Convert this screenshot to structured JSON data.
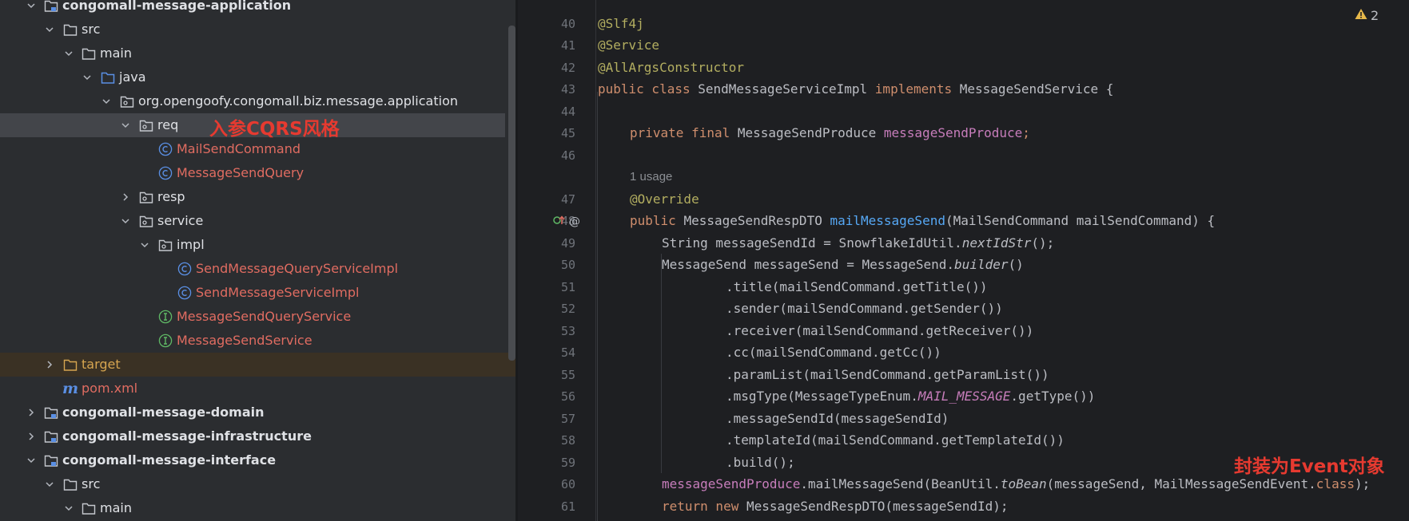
{
  "tree": {
    "items": [
      {
        "label": "congomall-message-application",
        "icon": "module-folder-icon"
      },
      {
        "label": "src",
        "icon": "folder-icon"
      },
      {
        "label": "main",
        "icon": "folder-icon"
      },
      {
        "label": "java",
        "icon": "source-folder-icon"
      },
      {
        "label": "org.opengoofy.congomall.biz.message.application",
        "icon": "package-icon"
      },
      {
        "label": "req",
        "icon": "package-icon"
      },
      {
        "label": "MailSendCommand",
        "icon": "class-icon"
      },
      {
        "label": "MessageSendQuery",
        "icon": "class-icon"
      },
      {
        "label": "resp",
        "icon": "package-icon"
      },
      {
        "label": "service",
        "icon": "package-icon"
      },
      {
        "label": "impl",
        "icon": "package-icon"
      },
      {
        "label": "SendMessageQueryServiceImpl",
        "icon": "class-icon"
      },
      {
        "label": "SendMessageServiceImpl",
        "icon": "class-icon"
      },
      {
        "label": "MessageSendQueryService",
        "icon": "interface-icon"
      },
      {
        "label": "MessageSendService",
        "icon": "interface-icon"
      },
      {
        "label": "target",
        "icon": "excluded-folder-icon"
      },
      {
        "label": "pom.xml",
        "icon": "maven-icon",
        "glyph": "m"
      },
      {
        "label": "congomall-message-domain",
        "icon": "module-folder-icon"
      },
      {
        "label": "congomall-message-infrastructure",
        "icon": "module-folder-icon"
      },
      {
        "label": "congomall-message-interface",
        "icon": "module-folder-icon"
      },
      {
        "label": "src",
        "icon": "folder-icon"
      },
      {
        "label": "main",
        "icon": "folder-icon"
      }
    ]
  },
  "annotations": {
    "tree_note": "入参CQRS风格",
    "code_note": "封装为Event对象"
  },
  "editor": {
    "warning_count": "2",
    "gutter_override": "@",
    "line_numbers": [
      "40",
      "41",
      "42",
      "43",
      "44",
      "45",
      "46",
      "47",
      "48",
      "49",
      "50",
      "51",
      "52",
      "53",
      "54",
      "55",
      "56",
      "57",
      "58",
      "59",
      "60",
      "61"
    ],
    "usage_hint": "1 usage",
    "code": {
      "l40": "@Slf4j",
      "l41": "@Service",
      "l42": "@AllArgsConstructor",
      "l43_kw": "public class ",
      "l43_name": "SendMessageServiceImpl ",
      "l43_kw2": "implements ",
      "l43_rest": "MessageSendService {",
      "l45_kw": "private final ",
      "l45_type": "MessageSendProduce ",
      "l45_field": "messageSendProduce",
      "l45_end": ";",
      "l47": "@Override",
      "l48_kw": "public ",
      "l48_type": "MessageSendRespDTO ",
      "l48_method": "mailMessageSend",
      "l48_rest": "(MailSendCommand mailSendCommand) {",
      "l49_a": "String messageSendId = SnowflakeIdUtil.",
      "l49_b": "nextIdStr",
      "l49_c": "();",
      "l50_a": "MessageSend messageSend = MessageSend.",
      "l50_b": "builder",
      "l50_c": "()",
      "l51": ".title(mailSendCommand.getTitle())",
      "l52": ".sender(mailSendCommand.getSender())",
      "l53": ".receiver(mailSendCommand.getReceiver())",
      "l54": ".cc(mailSendCommand.getCc())",
      "l55": ".paramList(mailSendCommand.getParamList())",
      "l56_a": ".msgType(MessageTypeEnum.",
      "l56_b": "MAIL_MESSAGE",
      "l56_c": ".getType())",
      "l57": ".messageSendId(messageSendId)",
      "l58": ".templateId(mailSendCommand.getTemplateId())",
      "l59": ".build();",
      "l60_a": "messageSendProduce",
      "l60_b": ".mailMessageSend(BeanUtil.",
      "l60_c": "toBean",
      "l60_d": "(messageSend, MailMessageSendEvent.",
      "l60_e": "class",
      "l60_f": ");",
      "l61_kw": "return new ",
      "l61_rest": "MessageSendRespDTO(messageSendId);"
    }
  },
  "colors": {
    "accent_red_note": "#e63a30",
    "class_name_red": "#e06c61",
    "keyword": "#cf8e6d",
    "annotation": "#b3ae60",
    "field": "#c77dbb",
    "method": "#56a8f5"
  }
}
